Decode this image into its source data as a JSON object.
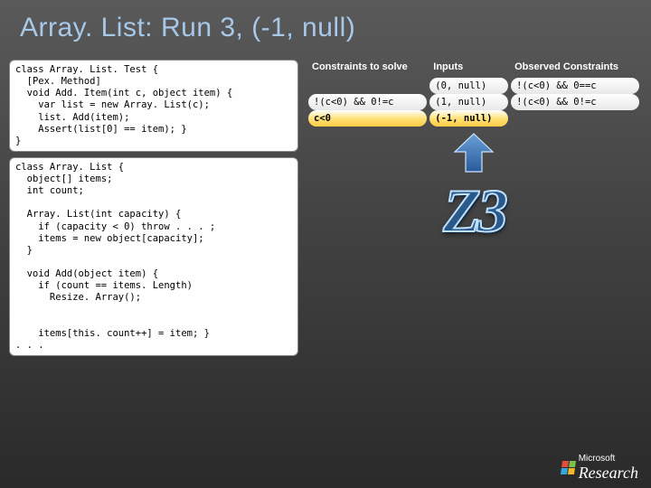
{
  "title": "Array. List: Run 3, (-1, null)",
  "code1": "class Array. List. Test {\n  [Pex. Method]\n  void Add. Item(int c, object item) {\n    var list = new Array. List(c);\n    list. Add(item);\n    Assert(list[0] == item); }\n}",
  "code2": "class Array. List {\n  object[] items;\n  int count;\n\n  Array. List(int capacity) {\n    if (capacity < 0) throw . . . ;\n    items = new object[capacity];\n  }\n\n  void Add(object item) {\n    if (count == items. Length)\n      Resize. Array();\n\n\n    items[this. count++] = item; }\n. . .",
  "table": {
    "headers": {
      "c0": "Constraints to solve",
      "c1": "Inputs",
      "c2": "Observed Constraints"
    },
    "rows": [
      {
        "c0": "",
        "c1": "(0, null)",
        "c2": "!(c<0) && 0==c"
      },
      {
        "c0": "!(c<0) && 0!=c",
        "c1": "(1, null)",
        "c2": "!(c<0) && 0!=c"
      },
      {
        "c0": "c<0",
        "c1": "(-1, null)",
        "c2": ""
      }
    ],
    "highlightRow": 2,
    "highlightCols": [
      0,
      1
    ]
  },
  "logo": "Z3",
  "footer": {
    "ms": "Microsoft",
    "research": "Research"
  }
}
